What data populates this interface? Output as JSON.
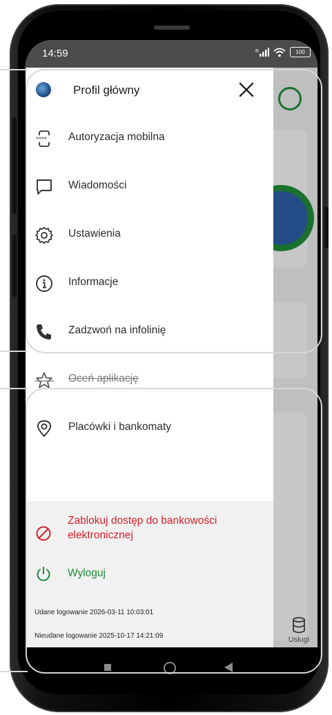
{
  "status_bar": {
    "time": "14:59",
    "signal_label": "R",
    "battery_level": "100"
  },
  "drawer": {
    "profile_name": "Profil główny",
    "menu_items": [
      {
        "label": "Autoryzacja mobilna",
        "icon": "mobile-authorization-icon"
      },
      {
        "label": "Wiadomości",
        "icon": "message-icon"
      },
      {
        "label": "Ustawienia",
        "icon": "gear-icon"
      },
      {
        "label": "Informacje",
        "icon": "info-icon"
      },
      {
        "label": "Zadzwoń na infolinię",
        "icon": "phone-icon"
      },
      {
        "label": "Oceń aplikację",
        "icon": "star-icon"
      },
      {
        "label": "Placówki i bankomaty",
        "icon": "location-pin-icon"
      }
    ],
    "block_access_label": "Zablokuj dostęp do bankowości elektronicznej",
    "logout_label": "Wyloguj",
    "last_login_success": "Udane logowanie 2026-03-11 10:03:01",
    "last_login_failed": "Nieudane logowanie 2025-10-17 14:21:09"
  },
  "background_app": {
    "services_label": "Usługi"
  },
  "colors": {
    "accent_green": "#1f8a38",
    "danger_red": "#d61f26",
    "status_bar": "#4b4b4b"
  }
}
